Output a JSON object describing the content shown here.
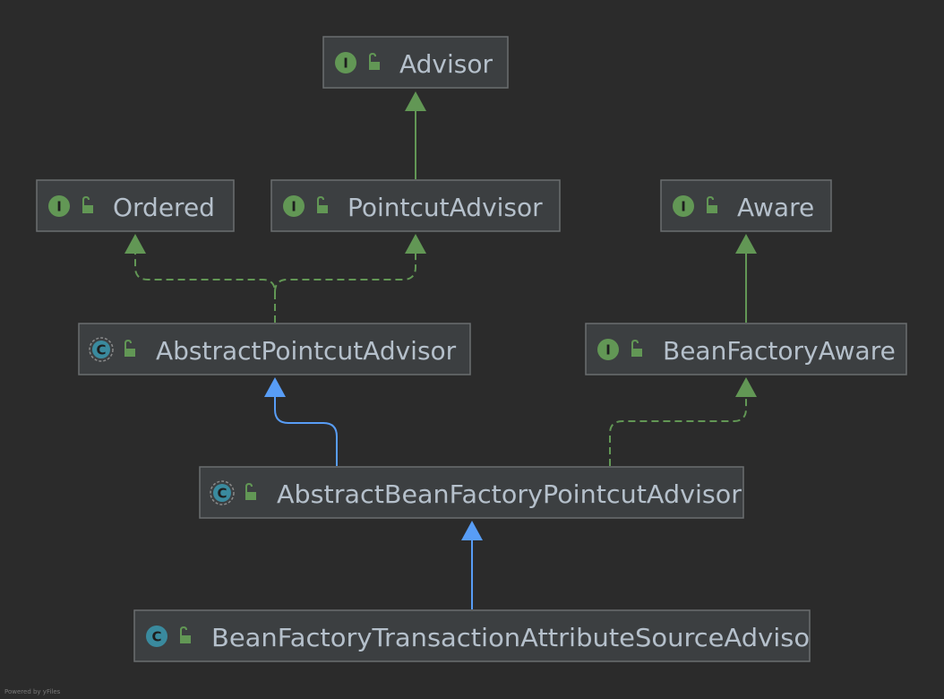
{
  "diagram": {
    "nodes": [
      {
        "id": "advisor",
        "label": "Advisor",
        "kind": "I"
      },
      {
        "id": "ordered",
        "label": "Ordered",
        "kind": "I"
      },
      {
        "id": "pointcut-advisor",
        "label": "PointcutAdvisor",
        "kind": "I"
      },
      {
        "id": "aware",
        "label": "Aware",
        "kind": "I"
      },
      {
        "id": "abstract-pointcut-advisor",
        "label": "AbstractPointcutAdvisor",
        "kind": "C"
      },
      {
        "id": "bean-factory-aware",
        "label": "BeanFactoryAware",
        "kind": "I"
      },
      {
        "id": "abstract-bean-factory-pointcut-advisor",
        "label": "AbstractBeanFactoryPointcutAdvisor",
        "kind": "C"
      },
      {
        "id": "bean-factory-transaction-attribute-source-advisor",
        "label": "BeanFactoryTransactionAttributeSourceAdvisor",
        "kind": "C"
      }
    ],
    "edges": [
      {
        "from": "pointcut-advisor",
        "to": "advisor",
        "relation": "extends"
      },
      {
        "from": "abstract-pointcut-advisor",
        "to": "ordered",
        "relation": "implements"
      },
      {
        "from": "abstract-pointcut-advisor",
        "to": "pointcut-advisor",
        "relation": "implements"
      },
      {
        "from": "bean-factory-aware",
        "to": "aware",
        "relation": "extends"
      },
      {
        "from": "abstract-bean-factory-pointcut-advisor",
        "to": "abstract-pointcut-advisor",
        "relation": "extends"
      },
      {
        "from": "abstract-bean-factory-pointcut-advisor",
        "to": "bean-factory-aware",
        "relation": "implements"
      },
      {
        "from": "bean-factory-transaction-attribute-source-advisor",
        "to": "abstract-bean-factory-pointcut-advisor",
        "relation": "extends"
      }
    ],
    "interface_marker": "I",
    "class_marker": "C",
    "watermark": "Powered by yFiles"
  }
}
